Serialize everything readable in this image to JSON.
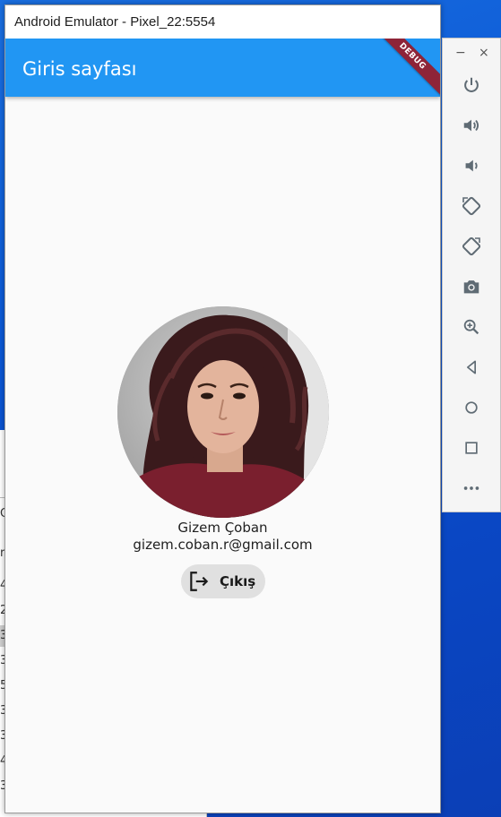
{
  "window": {
    "title": "Android Emulator - Pixel_22:5554"
  },
  "app": {
    "appbar_title": "Giris sayfası",
    "debug_banner": "DEBUG",
    "primary_color": "#2196f3"
  },
  "profile": {
    "name": "Gizem Çoban",
    "email": "gizem.coban.r@gmail.com",
    "logout_label": "Çıkış"
  },
  "toolbar": {
    "minimize": "−",
    "close": "×",
    "buttons": [
      "power-icon",
      "volume-up-icon",
      "volume-down-icon",
      "rotate-left-icon",
      "rotate-right-icon",
      "camera-icon",
      "zoom-icon",
      "back-icon",
      "home-icon",
      "overview-icon",
      "more-icon"
    ]
  },
  "background_window": {
    "row_glyphs": [
      "Q",
      "ri",
      "4",
      "2",
      "3",
      "3",
      "5",
      "3",
      "3",
      "4",
      "3"
    ]
  }
}
